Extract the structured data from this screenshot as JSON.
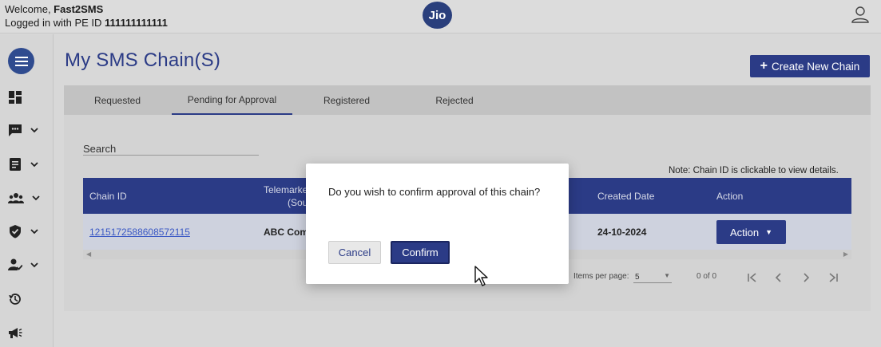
{
  "header": {
    "welcome_prefix": "Welcome, ",
    "welcome_name": "Fast2SMS",
    "login_prefix": "Logged in with PE ID ",
    "pe_id": "111111111111",
    "logo_text": "Jio",
    "user_icon": "user-icon"
  },
  "sidebar": {
    "menu_icon": "hamburger-icon",
    "items": [
      {
        "icon": "dashboard-icon",
        "has_chevron": false
      },
      {
        "icon": "chat-icon",
        "has_chevron": true
      },
      {
        "icon": "document-icon",
        "has_chevron": true
      },
      {
        "icon": "group-icon",
        "has_chevron": true
      },
      {
        "icon": "shield-check-icon",
        "has_chevron": true
      },
      {
        "icon": "user-check-icon",
        "has_chevron": true
      },
      {
        "icon": "history-icon",
        "has_chevron": false
      },
      {
        "icon": "megaphone-icon",
        "has_chevron": false
      }
    ]
  },
  "main": {
    "title": "My SMS Chain(S)",
    "create_button": "Create New Chain",
    "tabs": [
      {
        "label": "Requested",
        "active": false
      },
      {
        "label": "Pending for Approval",
        "active": true
      },
      {
        "label": "Registered",
        "active": false
      },
      {
        "label": "Rejected",
        "active": false
      }
    ],
    "search_label": "Search",
    "note": "Note: Chain ID is clickable to view details.",
    "table": {
      "headers": [
        "Chain ID",
        "Telemarke",
        "(Sou",
        "Created Date",
        "Action"
      ],
      "rows": [
        {
          "chain_id": "1215172588608572115",
          "telemarketer": "ABC Com",
          "created_date": "24-10-2024",
          "action": "Action"
        }
      ]
    },
    "pager": {
      "items_per_page_label": "Items per page:",
      "items_per_page": "5",
      "range": "0 of 0"
    }
  },
  "modal": {
    "message": "Do you wish to confirm approval of this chain?",
    "cancel": "Cancel",
    "confirm": "Confirm"
  },
  "colors": {
    "primary": "#2b3b86",
    "link": "#3a58c4",
    "overlay_bg": "#d8d8d8"
  }
}
